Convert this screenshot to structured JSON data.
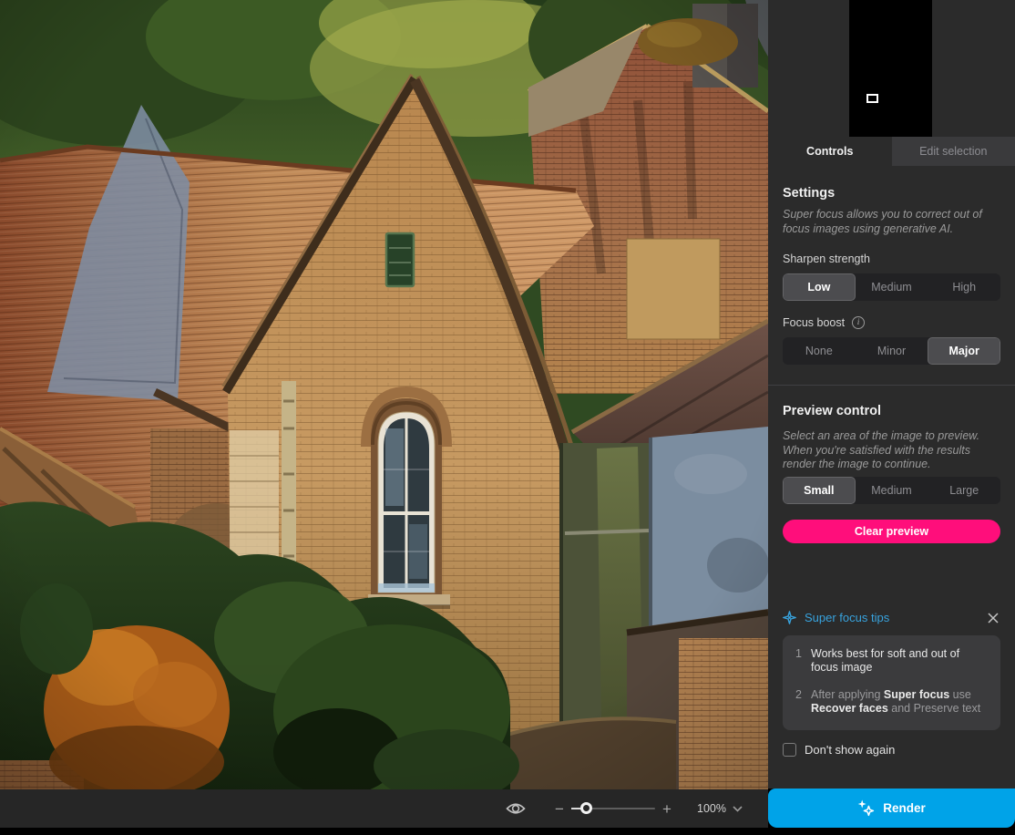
{
  "tabs": {
    "controls": "Controls",
    "edit_selection": "Edit selection"
  },
  "settings": {
    "title": "Settings",
    "description": "Super focus allows you to correct out of focus images using generative AI.",
    "sharpen_strength": {
      "label": "Sharpen strength",
      "options": [
        "Low",
        "Medium",
        "High"
      ],
      "selected": "Low"
    },
    "focus_boost": {
      "label": "Focus boost",
      "options": [
        "None",
        "Minor",
        "Major"
      ],
      "selected": "Major"
    }
  },
  "preview_control": {
    "title": "Preview control",
    "description": "Select an area of the image to preview. When you're satisfied with the results render the image to continue.",
    "size": {
      "options": [
        "Small",
        "Medium",
        "Large"
      ],
      "selected": "Small"
    },
    "clear_button": "Clear preview"
  },
  "tips": {
    "title": "Super focus tips",
    "items": [
      {
        "number": "1",
        "parts": [
          {
            "text": "Works best for soft and out of focus image",
            "style": "strong"
          }
        ]
      },
      {
        "number": "2",
        "parts": [
          {
            "text": "After applying ",
            "style": "dim"
          },
          {
            "text": "Super focus",
            "style": "strong"
          },
          {
            "text": " use ",
            "style": "dim"
          },
          {
            "text": "Recover faces",
            "style": "strong"
          },
          {
            "text": " and ",
            "style": "dim"
          },
          {
            "text": "Preserve text",
            "style": "dim"
          }
        ]
      }
    ],
    "dont_show_again": "Don't show again",
    "checkbox_checked": false
  },
  "footer": {
    "zoom_level": "100%",
    "render_button": "Render"
  },
  "icons": {
    "preview_original": "eye-icon",
    "zoom_out": "minus-icon",
    "zoom_in": "plus-icon",
    "zoom_menu": "chevron-down-icon",
    "focus_boost_help": "info-icon",
    "tips": "sparkle-icon",
    "tips_close": "close-icon",
    "render": "sparkles-icon"
  },
  "colors": {
    "panel_bg": "#2b2b2b",
    "accent_pink": "#ff0e7b",
    "accent_cyan": "#00a3e8",
    "tips_blue": "#38a3de"
  }
}
